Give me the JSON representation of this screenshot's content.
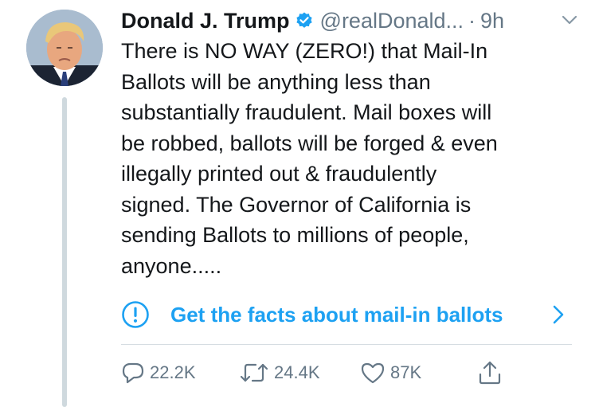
{
  "author": {
    "name": "Donald J. Trump",
    "handle": "@realDonald...",
    "separator": "·",
    "time": "9h"
  },
  "tweet": {
    "lines": [
      "There is NO WAY (ZERO!) that Mail-In",
      "Ballots will be anything less than",
      "substantially fraudulent. Mail boxes will",
      "be robbed, ballots will be forged & even",
      "illegally printed out & fraudulently",
      "signed. The Governor of California is",
      "sending Ballots to millions of people,",
      "anyone....."
    ]
  },
  "notice": {
    "label": "Get the facts about mail-in ballots",
    "icon": "exclamation-circle-icon"
  },
  "actions": {
    "replies": "22.2K",
    "retweets": "24.4K",
    "likes": "87K"
  },
  "colors": {
    "accent": "#1da1f2",
    "secondary_text": "#657786",
    "primary_text": "#14171a",
    "divider": "#d6dde2",
    "thread_line": "#cfd9de"
  }
}
